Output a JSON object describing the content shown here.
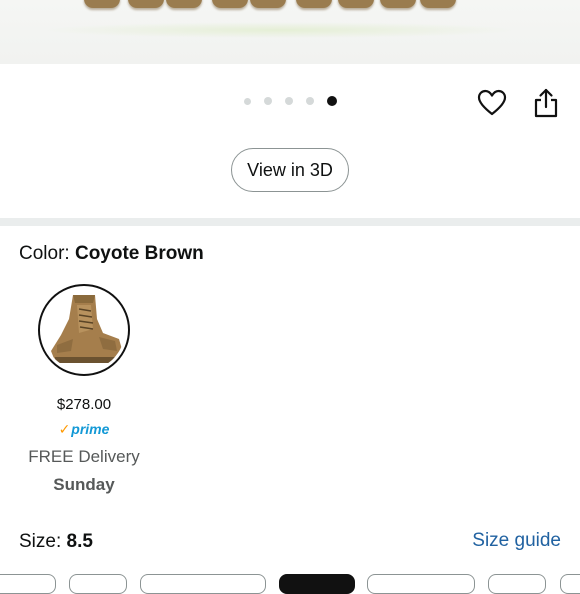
{
  "carousel": {
    "image_alt_icon": "boot-sole-image",
    "dots_count": 5,
    "active_index": 4
  },
  "actions": {
    "wishlist_icon": "heart-icon",
    "share_icon": "share-icon"
  },
  "view3d": {
    "label": "View in 3D"
  },
  "color": {
    "label": "Color: ",
    "value": "Coyote Brown",
    "swatch": {
      "image_icon": "coyote-brown-boot-thumbnail",
      "price": "$278.00",
      "prime_check": "✓",
      "prime_label": "prime",
      "delivery_line1": "FREE Delivery",
      "delivery_line2": "Sunday"
    }
  },
  "size": {
    "label": "Size: ",
    "value": "8.5",
    "guide_link": "Size guide",
    "selected_index": 3
  },
  "colors": {
    "link": "#2162a1",
    "prime": "#1399d6",
    "prime_check": "#ff9900",
    "divider": "#eaeded"
  }
}
